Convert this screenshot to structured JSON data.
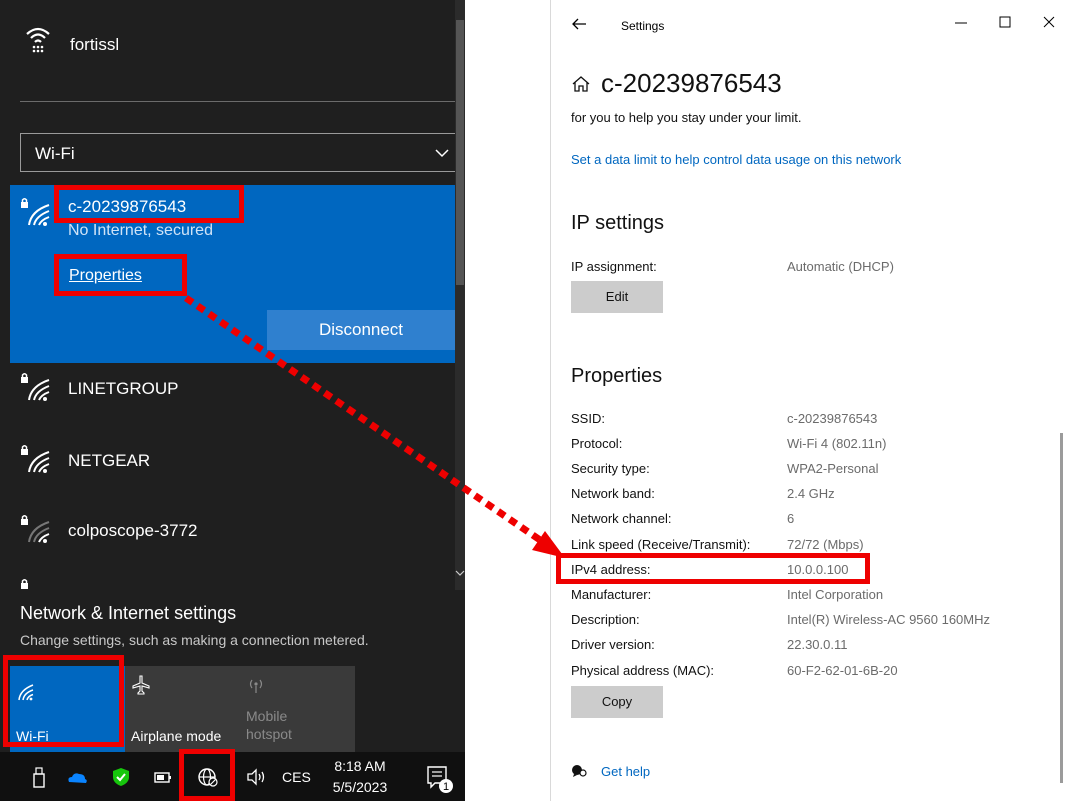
{
  "flyout": {
    "top_network": {
      "name": "fortissl"
    },
    "dropdown": {
      "selected": "Wi-Fi"
    },
    "connected": {
      "name": "c-20239876543",
      "status": "No Internet, secured",
      "properties_link": "Properties",
      "disconnect_label": "Disconnect"
    },
    "networks": [
      {
        "name": "LINETGROUP"
      },
      {
        "name": "NETGEAR"
      },
      {
        "name": "colposcope-3772"
      }
    ],
    "settings_link": "Network & Internet settings",
    "settings_desc": "Change settings, such as making a connection metered.",
    "quick_actions": {
      "wifi": "Wi-Fi",
      "airplane": "Airplane mode",
      "hotspot_line1": "Mobile",
      "hotspot_line2": "hotspot"
    }
  },
  "taskbar": {
    "language": "CES",
    "time": "8:18 AM",
    "date": "5/5/2023",
    "notification_count": "1"
  },
  "settings_window": {
    "title": "Settings",
    "heading": "c-20239876543",
    "limit_text": "for you to help you stay under your limit.",
    "data_limit_link": "Set a data limit to help control data usage on this network",
    "ip_settings": {
      "title": "IP settings",
      "assignment_label": "IP assignment:",
      "assignment_value": "Automatic (DHCP)",
      "edit_label": "Edit"
    },
    "properties": {
      "title": "Properties",
      "rows": [
        {
          "key": "SSID:",
          "value": "c-20239876543"
        },
        {
          "key": "Protocol:",
          "value": "Wi-Fi 4 (802.11n)"
        },
        {
          "key": "Security type:",
          "value": "WPA2-Personal"
        },
        {
          "key": "Network band:",
          "value": "2.4 GHz"
        },
        {
          "key": "Network channel:",
          "value": "6"
        },
        {
          "key": "Link speed (Receive/Transmit):",
          "value": "72/72 (Mbps)"
        },
        {
          "key": "IPv4 address:",
          "value": "10.0.0.100"
        },
        {
          "key": "Manufacturer:",
          "value": "Intel Corporation"
        },
        {
          "key": "Description:",
          "value": "Intel(R) Wireless-AC 9560 160MHz"
        },
        {
          "key": "Driver version:",
          "value": "22.30.0.11"
        },
        {
          "key": "Physical address (MAC):",
          "value": "60-F2-62-01-6B-20"
        }
      ],
      "copy_label": "Copy"
    },
    "get_help": "Get help"
  },
  "colors": {
    "accent": "#0067c0",
    "flyout_bg": "#1f1f1f",
    "annotation": "#ee0000"
  }
}
